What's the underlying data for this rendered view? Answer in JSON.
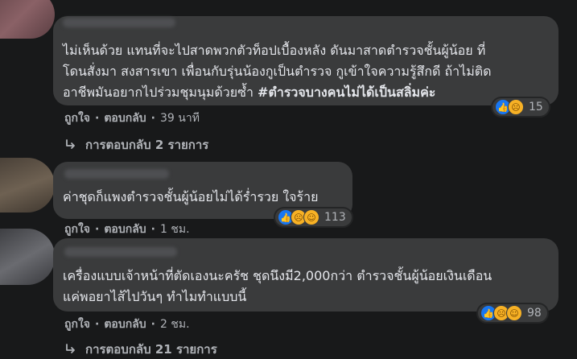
{
  "comments": [
    {
      "lines": [
        "ไม่เห็นด้วย แทนที่จะไปสาดพวกตัวท็อปเบื้องหลัง ดันมาสาดตำรวจชั้นผู้น้อย ที่",
        "โดนสั่งมา สงสารเขา เพื่อนกับรุ่นน้องกูเป็นตำรวจ กูเข้าใจความรู้สึกดี ถ้าไม่ติด",
        "อาชีพมันอยากไปร่วมชุมนุมด้วยซ้ำ "
      ],
      "hashtag": "#ตำรวจบางคนไม่ได้เป็นสลิ่มค่ะ",
      "reactions": [
        "like-icon",
        "sad-icon"
      ],
      "reaction_count": "15",
      "like_label": "ถูกใจ",
      "reply_label": "ตอบกลับ",
      "time": "39 นาที",
      "replies_label": "การตอบกลับ 2 รายการ"
    },
    {
      "lines": [
        "ค่าชุดก็แพงตำรวจชั้นผู้น้อยไม่ได้ร่ำรวย ใจร้าย"
      ],
      "reactions": [
        "like-icon",
        "sad-icon",
        "haha-icon"
      ],
      "reaction_count": "113",
      "like_label": "ถูกใจ",
      "reply_label": "ตอบกลับ",
      "time": "1 ชม."
    },
    {
      "lines": [
        "เครื่องแบบเจ้าหน้าที่ตัดเองนะครัช ชุดนึงมี2,000กว่า ตำรวจชั้นผู้น้อยเงินเดือน",
        "แค่พอยาไส้ไปวันๆ ทำไมทำแบบนี้"
      ],
      "reactions": [
        "like-icon",
        "sad-icon",
        "haha-icon"
      ],
      "reaction_count": "98",
      "like_label": "ถูกใจ",
      "reply_label": "ตอบกลับ",
      "time": "2 ชม.",
      "replies_label": "การตอบกลับ 21 รายการ"
    }
  ],
  "separator": "·",
  "colors": {
    "background": "#18191a",
    "bubble": "#3a3b3c",
    "text": "#e4e6eb",
    "secondary_text": "#b0b3b8",
    "like_blue": "#1877f2",
    "emoji_yellow": "#f7b125"
  }
}
